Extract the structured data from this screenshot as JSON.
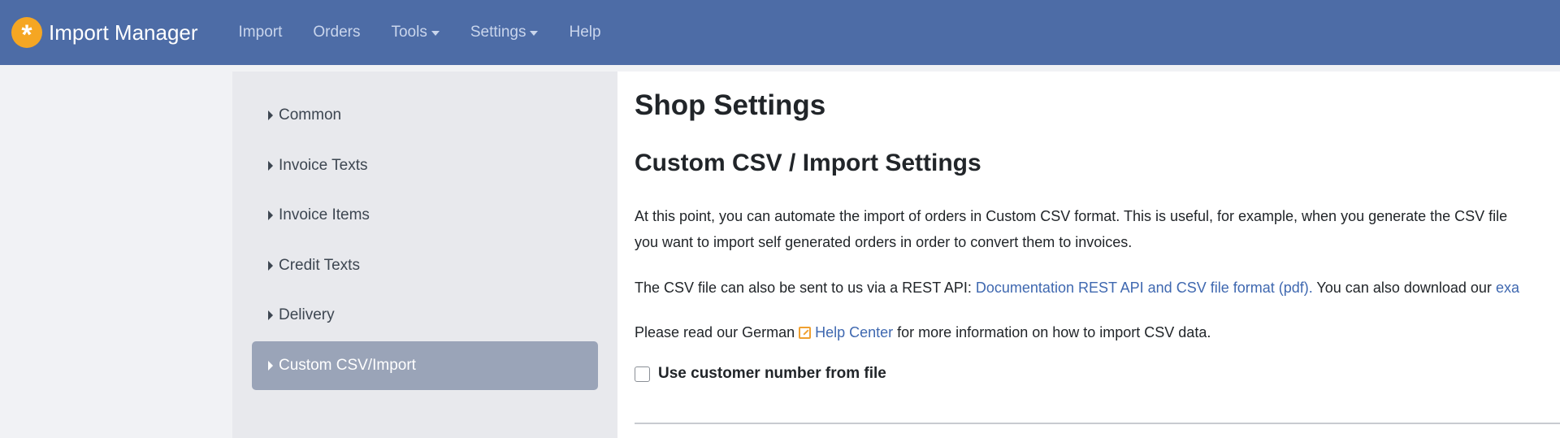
{
  "navbar": {
    "brand": "Import Manager",
    "items": [
      {
        "label": "Import"
      },
      {
        "label": "Orders"
      },
      {
        "label": "Tools"
      },
      {
        "label": "Settings"
      },
      {
        "label": "Help"
      }
    ]
  },
  "sidebar": {
    "items": [
      {
        "label": "Common"
      },
      {
        "label": "Invoice Texts"
      },
      {
        "label": "Invoice Items"
      },
      {
        "label": "Credit Texts"
      },
      {
        "label": "Delivery"
      },
      {
        "label": "Custom CSV/Import"
      }
    ]
  },
  "main": {
    "page_title": "Shop Settings",
    "section_title": "Custom CSV / Import Settings",
    "para1_line1": "At this point, you can automate the import of orders in Custom CSV format. This is useful, for example, when you generate the CSV file",
    "para1_line2": "you want to import self generated orders in order to convert them to invoices.",
    "para2_prefix": "The CSV file can also be sent to us via a REST API: ",
    "para2_link": "Documentation REST API and CSV file format (pdf).",
    "para2_suffix": " You can also download our ",
    "para2_link2": "exa",
    "para3_prefix": "Please read our German ",
    "para3_link": "Help Center",
    "para3_suffix": " for more information on how to import CSV data.",
    "checkbox_label": "Use customer number from file"
  }
}
